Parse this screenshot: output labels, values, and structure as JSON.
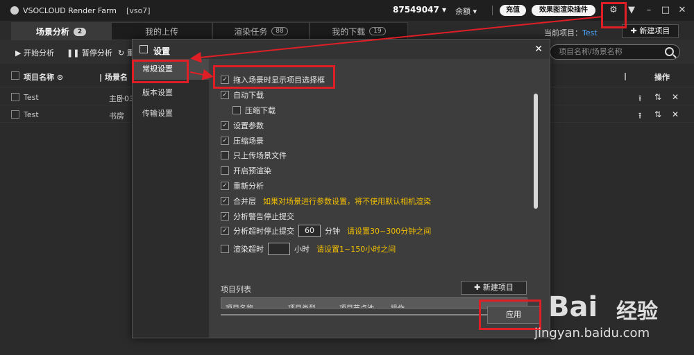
{
  "titlebar": {
    "app_name": "VSOCLOUD Render Farm",
    "version": "[vso7]",
    "account": "87549047",
    "balance_label": "余额",
    "recharge_label": "充值",
    "plugin_label": "效果图渲染插件"
  },
  "tabs": [
    {
      "label": "场景分析",
      "badge": "2"
    },
    {
      "label": "我的上传",
      "badge": ""
    },
    {
      "label": "渲染任务",
      "badge": "88"
    },
    {
      "label": "我的下载",
      "badge": "19"
    }
  ],
  "current_project": {
    "label": "当前项目：",
    "value": "Test"
  },
  "new_project_label": "新建项目",
  "toolbar": {
    "start_label": "开始分析",
    "pause_label": "暂停分析",
    "redo_label": "重",
    "search_placeholder": "项目名称/场景名称"
  },
  "table": {
    "col_project": "项目名称",
    "col_scene": "场景名",
    "col_actions": "操作",
    "rows": [
      {
        "project": "Test",
        "scene": "主卧03"
      },
      {
        "project": "Test",
        "scene": "书房"
      }
    ]
  },
  "dialog": {
    "title": "设置",
    "nav": [
      "常规设置",
      "版本设置",
      "传输设置"
    ],
    "options": [
      {
        "label": "拖入场景时显示项目选择框",
        "checked": true
      },
      {
        "label": "自动下载",
        "checked": true
      },
      {
        "label": "压缩下载",
        "checked": false
      },
      {
        "label": "设置参数",
        "checked": true
      },
      {
        "label": "压缩场景",
        "checked": true
      },
      {
        "label": "只上传场景文件",
        "checked": false
      },
      {
        "label": "开启预渲染",
        "checked": false
      },
      {
        "label": "重新分析",
        "checked": true
      },
      {
        "label": "合并层",
        "checked": true,
        "hint": "如果对场景进行参数设置，将不使用默认相机渲染"
      },
      {
        "label": "分析警告停止提交",
        "checked": true
      },
      {
        "label": "分析超时停止提交",
        "checked": true,
        "value": "60",
        "unit": "分钟",
        "hint": "请设置30~300分钟之间"
      },
      {
        "label": "渲染超时",
        "checked": false,
        "value": "",
        "unit": "小时",
        "hint": "请设置1~150小时之间"
      }
    ],
    "project_list_title": "项目列表",
    "project_list_new": "新建项目",
    "project_list_columns": [
      "项目名称",
      "项目类型",
      "项目节点池",
      "操作"
    ],
    "apply_label": "应用"
  },
  "watermark": {
    "brand": "Bai",
    "brand2": "经验",
    "url": "jingyan.baidu.com"
  }
}
